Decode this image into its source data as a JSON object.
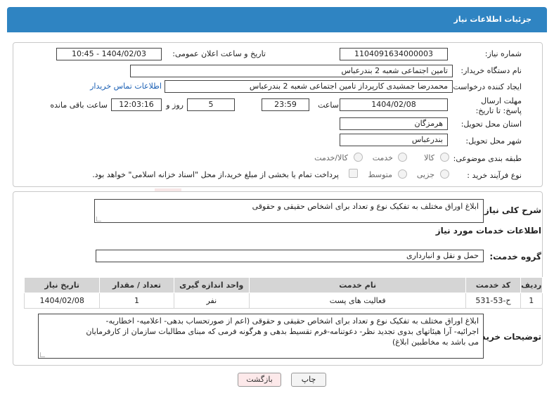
{
  "title": "جزئیات اطلاعات نیاز",
  "watermark": "AriaTender.neT",
  "fields": {
    "need_number_label": "شماره نیاز:",
    "need_number": "1104091634000003",
    "announce_label": "تاریخ و ساعت اعلان عمومی:",
    "announce_value": "1404/02/03 - 10:45",
    "buyer_label": "نام دستگاه خریدار:",
    "buyer_value": "تامین اجتماعی شعبه 2 بندرعباس",
    "creator_label": "ایجاد کننده درخواست:",
    "creator_value": "محمدرضا جمشیدی کارپرداز تامین اجتماعی شعبه 2 بندرعباس",
    "contact_link": "اطلاعات تماس خریدار",
    "deadline_label": "مهلت ارسال پاسخ: تا تاریخ:",
    "deadline_date": "1404/02/08",
    "time_label": "ساعت",
    "deadline_time": "23:59",
    "days_value": "5",
    "days_label": "روز و",
    "remaining_value": "12:03:16",
    "remaining_label": "ساعت باقی مانده",
    "province_label": "استان محل تحویل:",
    "province_value": "هرمزگان",
    "city_label": "شهر محل تحویل:",
    "city_value": "بندرعباس",
    "category_label": "طبقه بندی موضوعی:",
    "category_options": [
      "کالا",
      "خدمت",
      "کالا/خدمت"
    ],
    "process_label": "نوع فرآیند خرید :",
    "process_options": [
      "جزیی",
      "متوسط"
    ],
    "payment_note": "پرداخت تمام یا بخشی از مبلغ خرید،از محل \"اسناد خزانه اسلامی\" خواهد بود."
  },
  "summary": {
    "label": "شرح کلی نیاز:",
    "value": "ابلاغ اوراق مختلف به تفکیک نوع و تعداد برای اشخاص حقیقی و حقوقی"
  },
  "services": {
    "section_title": "اطلاعات خدمات مورد نیاز",
    "group_label": "گروه خدمت:",
    "group_value": "حمل و نقل و انبارداری",
    "columns": [
      "ردیف",
      "کد خدمت",
      "نام خدمت",
      "واحد اندازه گیری",
      "تعداد / مقدار",
      "تاریخ نیاز"
    ],
    "rows": [
      [
        "1",
        "ح-53-531",
        "فعالیت های پست",
        "نفر",
        "1",
        "1404/02/08"
      ]
    ]
  },
  "buyer_notes": {
    "label": "توضیحات خریدار:",
    "line1": "ابلاغ اوراق مختلف به تفکیک نوع و تعداد برای اشخاص حقیقی و حقوقی (اعم از صورتحساب بدهی- اعلامیه- اخطاریه-",
    "line2": "اجرائیه- آرا هیئاتهای بدوی تجدید نظر- دعوتنامه-فرم تقسیط بدهی و هرگونه فرمی که مبنای مطالبات سازمان از کارفرمایان",
    "line3": "می باشد به مخاطبین ابلاغ)"
  },
  "buttons": {
    "print": "چاپ",
    "back": "بازگشت"
  },
  "colors": {
    "header": "#2f84c2",
    "watermark": "#e3a9a9",
    "table_header": "#d5d5d5"
  }
}
